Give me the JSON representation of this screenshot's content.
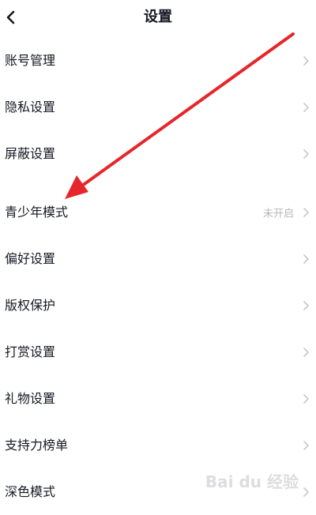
{
  "header": {
    "title": "设置",
    "back_icon": "chevron-left-icon"
  },
  "settings": {
    "group1": [
      {
        "label": "账号管理"
      },
      {
        "label": "隐私设置"
      },
      {
        "label": "屏蔽设置"
      }
    ],
    "group2": [
      {
        "label": "青少年模式",
        "value": "未开启"
      },
      {
        "label": "偏好设置"
      },
      {
        "label": "版权保护"
      },
      {
        "label": "打赏设置"
      },
      {
        "label": "礼物设置"
      },
      {
        "label": "支持力榜单"
      },
      {
        "label": "深色模式"
      }
    ],
    "row_icon": "chevron-right-icon"
  },
  "annotation": {
    "arrow_color": "#e5262a",
    "arrow_icon": "red-arrow-annotation"
  },
  "watermark": {
    "text": "Bai du 经验"
  },
  "colors": {
    "text": "#161823",
    "muted": "#b8b8bd",
    "chevron": "#c8c8cc"
  }
}
